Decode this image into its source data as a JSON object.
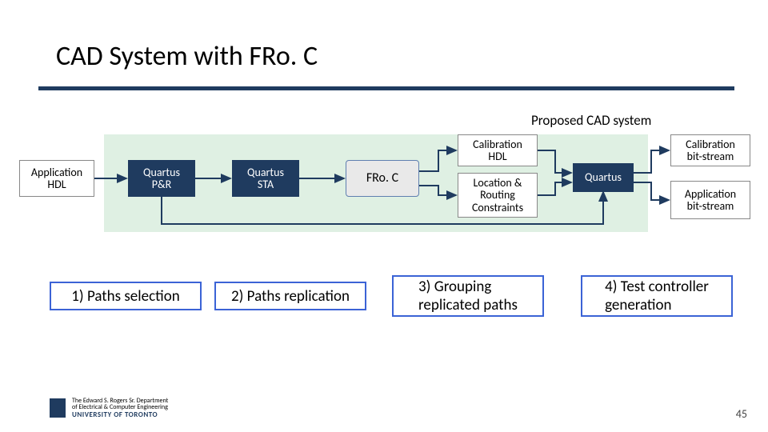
{
  "title": "CAD System with FRo. C",
  "caption": "Proposed CAD system",
  "nodes": {
    "app_hdl": "Application\nHDL",
    "q_pnr": "Quartus\nP&R",
    "q_sta": "Quartus\nSTA",
    "froc": "FRo. C",
    "cal_hdl": "Calibration\nHDL",
    "loc_route": "Location &\nRouting\nConstraints",
    "quartus": "Quartus",
    "cal_bit": "Calibration\nbit-stream",
    "app_bit": "Application\nbit-stream"
  },
  "steps": {
    "s1": "1) Paths selection",
    "s2": "2) Paths replication",
    "s3": "3) Grouping\nreplicated paths",
    "s4": "4) Test controller\ngeneration"
  },
  "pagenum": "45",
  "footer": {
    "dept": "The Edward S. Rogers Sr. Department\nof Electrical & Computer Engineering",
    "univ": "UNIVERSITY OF TORONTO"
  }
}
